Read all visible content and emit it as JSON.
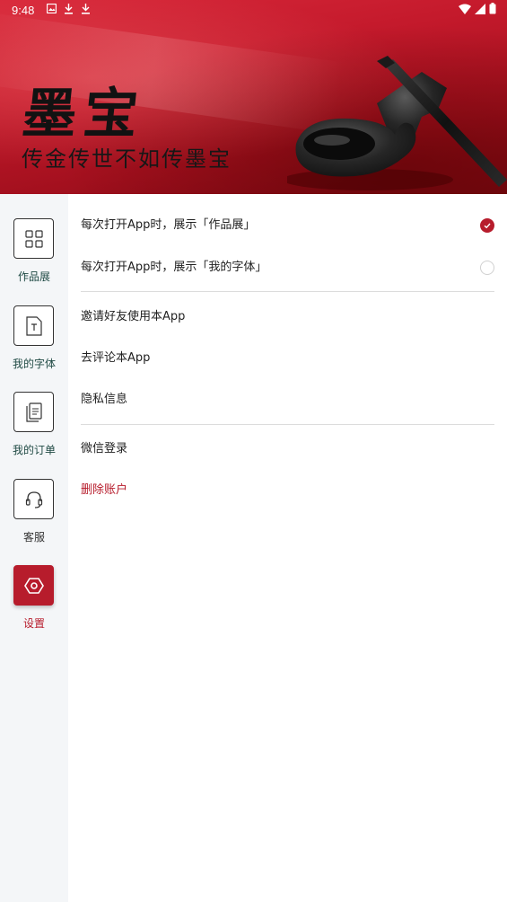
{
  "status_bar": {
    "time": "9:48",
    "left_icons": [
      "photo-icon",
      "download-icon",
      "download-icon"
    ],
    "right_icons": [
      "wifi-icon",
      "signal-icon",
      "battery-icon"
    ]
  },
  "banner": {
    "title": "墨宝",
    "slogan": "传金传世不如传墨宝",
    "colors": {
      "primary": "#c3192b",
      "ink": "#121212"
    }
  },
  "sidebar": {
    "items": [
      {
        "label": "作品展",
        "icon": "grid-icon",
        "active": false
      },
      {
        "label": "我的字体",
        "icon": "font-file-icon",
        "active": false
      },
      {
        "label": "我的订单",
        "icon": "orders-icon",
        "active": false
      },
      {
        "label": "客服",
        "icon": "headset-icon",
        "active": false
      },
      {
        "label": "设置",
        "icon": "settings-icon",
        "active": true
      }
    ]
  },
  "settings": {
    "startup_options": [
      {
        "label": "每次打开App时，展示「作品展」",
        "selected": true
      },
      {
        "label": "每次打开App时，展示「我的字体」",
        "selected": false
      }
    ],
    "general": [
      {
        "label": "邀请好友使用本App"
      },
      {
        "label": "去评论本App"
      },
      {
        "label": "隐私信息"
      }
    ],
    "account": [
      {
        "label": "微信登录"
      },
      {
        "label": "删除账户",
        "danger": true
      }
    ]
  },
  "theme": {
    "accent": "#b71c2c",
    "sidebar_bg": "#f4f6f8",
    "label_color": "#1f4a44"
  }
}
